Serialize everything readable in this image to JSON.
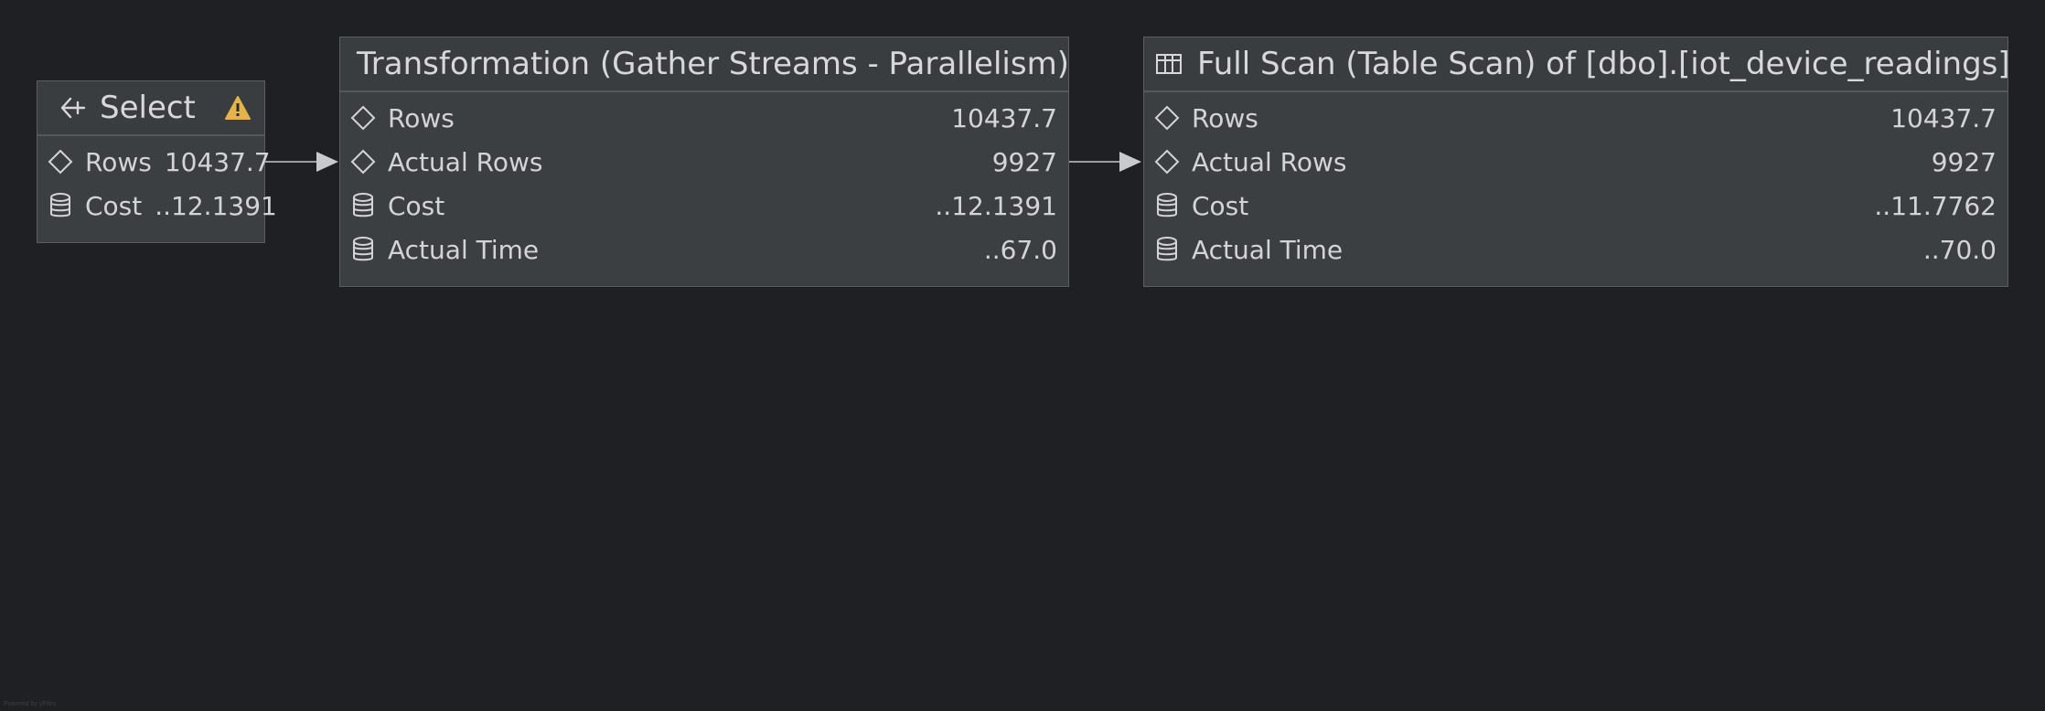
{
  "colors": {
    "background": "#1f2023",
    "node_fill": "#3c3f42",
    "node_border": "#5a5d61",
    "text": "#d4d6d9",
    "warning": "#e3b44a"
  },
  "nodes": [
    {
      "id": "select",
      "title": "Select",
      "header_icon": "arrow-left-icon",
      "warning_icon": "warning-icon",
      "rows": [
        {
          "icon": "diamond-icon",
          "label": "Rows",
          "value": "10437.7"
        },
        {
          "icon": "database-icon",
          "label": "Cost",
          "value": "..12.1391"
        }
      ]
    },
    {
      "id": "gather-streams",
      "title": "Transformation (Gather Streams - Parallelism)",
      "rows": [
        {
          "icon": "diamond-icon",
          "label": "Rows",
          "value": "10437.7"
        },
        {
          "icon": "diamond-icon",
          "label": "Actual Rows",
          "value": "9927"
        },
        {
          "icon": "database-icon",
          "label": "Cost",
          "value": "..12.1391"
        },
        {
          "icon": "database-icon",
          "label": "Actual Time",
          "value": "..67.0"
        }
      ]
    },
    {
      "id": "table-scan",
      "title": "Full Scan (Table Scan) of [dbo].[iot_device_readings]",
      "header_icon": "table-icon",
      "rows": [
        {
          "icon": "diamond-icon",
          "label": "Rows",
          "value": "10437.7"
        },
        {
          "icon": "diamond-icon",
          "label": "Actual Rows",
          "value": "9927"
        },
        {
          "icon": "database-icon",
          "label": "Cost",
          "value": "..11.7762"
        },
        {
          "icon": "database-icon",
          "label": "Actual Time",
          "value": "..70.0"
        }
      ]
    }
  ],
  "footer_text": "Powered by yFiles"
}
